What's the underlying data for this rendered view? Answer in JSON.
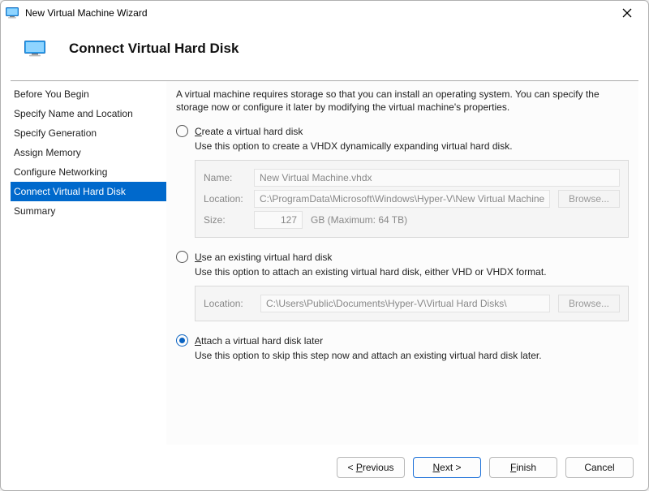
{
  "window": {
    "title": "New Virtual Machine Wizard"
  },
  "header": {
    "title": "Connect Virtual Hard Disk"
  },
  "sidebar": {
    "steps": [
      {
        "label": "Before You Begin"
      },
      {
        "label": "Specify Name and Location"
      },
      {
        "label": "Specify Generation"
      },
      {
        "label": "Assign Memory"
      },
      {
        "label": "Configure Networking"
      },
      {
        "label": "Connect Virtual Hard Disk"
      },
      {
        "label": "Summary"
      }
    ],
    "active_index": 5
  },
  "main": {
    "intro": "A virtual machine requires storage so that you can install an operating system. You can specify the storage now or configure it later by modifying the virtual machine's properties.",
    "option_create": {
      "label_pre": "",
      "label_u": "C",
      "label_post": "reate a virtual hard disk",
      "selected": false,
      "desc": "Use this option to create a VHDX dynamically expanding virtual hard disk.",
      "name_label_u": "N",
      "name_label_post": "ame:",
      "name_value": "New Virtual Machine.vhdx",
      "loc_label_u": "L",
      "loc_label_post": "ocation:",
      "loc_value": "C:\\ProgramData\\Microsoft\\Windows\\Hyper-V\\New Virtual Machine\\V",
      "browse_label_u": "B",
      "browse_label_post": "rowse...",
      "size_label_u": "S",
      "size_label_post": "ize:",
      "size_value": "127",
      "size_unit": "GB (Maximum: 64 TB)"
    },
    "option_existing": {
      "label_u": "U",
      "label_post": "se an existing virtual hard disk",
      "selected": false,
      "desc": "Use this option to attach an existing virtual hard disk, either VHD or VHDX format.",
      "loc_label": "Location:",
      "loc_value": "C:\\Users\\Public\\Documents\\Hyper-V\\Virtual Hard Disks\\",
      "browse_label": "Browse..."
    },
    "option_later": {
      "label_u": "A",
      "label_post": "ttach a virtual hard disk later",
      "selected": true,
      "desc": "Use this option to skip this step now and attach an existing virtual hard disk later."
    }
  },
  "footer": {
    "previous_pre": "< ",
    "previous_u": "P",
    "previous_post": "revious",
    "next_u": "N",
    "next_post": "ext >",
    "finish_u": "F",
    "finish_post": "inish",
    "cancel": "Cancel"
  }
}
